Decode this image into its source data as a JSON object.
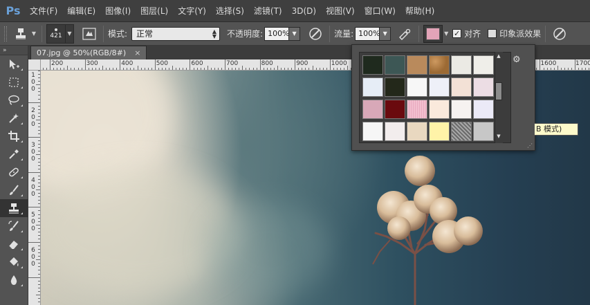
{
  "app": {
    "logo": "Ps"
  },
  "menu": [
    {
      "label": "文件(F)"
    },
    {
      "label": "编辑(E)"
    },
    {
      "label": "图像(I)"
    },
    {
      "label": "图层(L)"
    },
    {
      "label": "文字(Y)"
    },
    {
      "label": "选择(S)"
    },
    {
      "label": "滤镜(T)"
    },
    {
      "label": "3D(D)"
    },
    {
      "label": "视图(V)"
    },
    {
      "label": "窗口(W)"
    },
    {
      "label": "帮助(H)"
    }
  ],
  "options": {
    "brush_size": "421",
    "mode_label": "模式:",
    "mode_value": "正常",
    "opacity_label": "不透明度:",
    "opacity_value": "100%",
    "flow_label": "流量:",
    "flow_value": "100%",
    "pattern_color": "#e3a4b8",
    "align_label": "对齐",
    "align_checked": true,
    "impressionist_label": "印象派效果",
    "impressionist_checked": false
  },
  "document": {
    "tab_title": "07.jpg @ 50%(RGB/8#)",
    "close_symbol": "×"
  },
  "ruler_h": [
    "200",
    "300",
    "400",
    "500",
    "600",
    "700",
    "800",
    "900",
    "1000",
    "1600",
    "1700"
  ],
  "ruler_v": [
    [
      "1",
      "0",
      "0"
    ],
    [
      "2",
      "0",
      "0"
    ],
    [
      "3",
      "0",
      "0"
    ],
    [
      "4",
      "0",
      "0"
    ],
    [
      "5",
      "0",
      "0"
    ],
    [
      "6",
      "0",
      "0"
    ]
  ],
  "patterns": [
    [
      "#1f2a1e",
      "#3d5755",
      "#b98a5c",
      "#9c6a34",
      "#ebeae4",
      "#efeee9"
    ],
    [
      "#e6edf6",
      "#23281a",
      "#f7f7f7",
      "#eef0f8",
      "#f3e1d6",
      "#ecdde4"
    ],
    [
      "#d8a8b8",
      "#6a0a0e",
      "#f2bfcf",
      "#fae9dc",
      "#f6f2f0",
      "#ebeaf7"
    ],
    [
      "#f6f6f6",
      "#f2eded",
      "#e9d8c0",
      "#fff3a8",
      "#8f8f8f",
      "#c7c7c7"
    ]
  ],
  "tooltip": "B 模式)"
}
